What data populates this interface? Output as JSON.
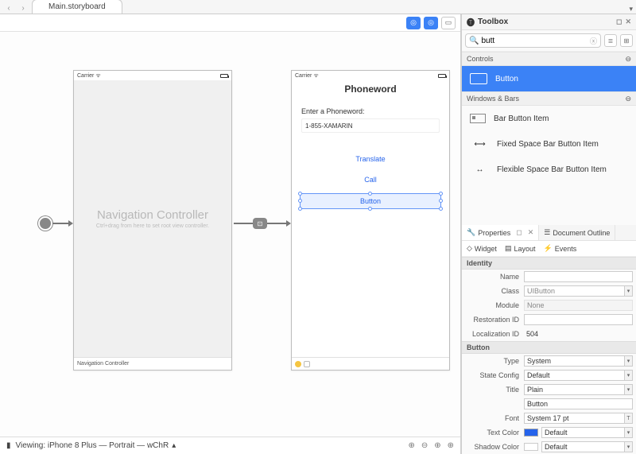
{
  "tab": {
    "title": "Main.storyboard"
  },
  "canvas": {
    "nav_controller_title": "Navigation Controller",
    "nav_controller_hint": "Ctrl+drag from here to set root view controller.",
    "nav_footer": "Navigation Controller",
    "carrier": "Carrier",
    "pw_title": "Phoneword",
    "pw_label": "Enter a Phoneword:",
    "pw_textfield": "1-855-XAMARIN",
    "pw_translate": "Translate",
    "pw_call": "Call",
    "pw_newbutton": "Button"
  },
  "status": {
    "viewing": "Viewing: iPhone 8 Plus — Portrait — wChR"
  },
  "toolbox": {
    "title": "Toolbox",
    "search": "butt",
    "group_controls": "Controls",
    "group_windows": "Windows & Bars",
    "items": {
      "button": "Button",
      "barbutton": "Bar Button Item",
      "fixedspace": "Fixed Space Bar Button Item",
      "flexspace": "Flexible Space Bar Button Item"
    }
  },
  "props": {
    "tab_properties": "Properties",
    "tab_outline": "Document Outline",
    "sub_widget": "Widget",
    "sub_layout": "Layout",
    "sub_events": "Events",
    "sec_identity": "Identity",
    "name_lbl": "Name",
    "name_val": "",
    "class_lbl": "Class",
    "class_val": "UIButton",
    "module_lbl": "Module",
    "module_val": "None",
    "restid_lbl": "Restoration ID",
    "restid_val": "",
    "locid_lbl": "Localization ID",
    "locid_val": "504",
    "sec_button": "Button",
    "type_lbl": "Type",
    "type_val": "System",
    "state_lbl": "State Config",
    "state_val": "Default",
    "title_lbl": "Title",
    "title_val": "Plain",
    "title_text": "Button",
    "font_lbl": "Font",
    "font_val": "System 17 pt",
    "textcolor_lbl": "Text Color",
    "textcolor_val": "Default",
    "textcolor_swatch": "#2563eb",
    "shadowcolor_lbl": "Shadow Color",
    "shadowcolor_val": "Default",
    "shadowcolor_swatch": "#ffffff"
  }
}
